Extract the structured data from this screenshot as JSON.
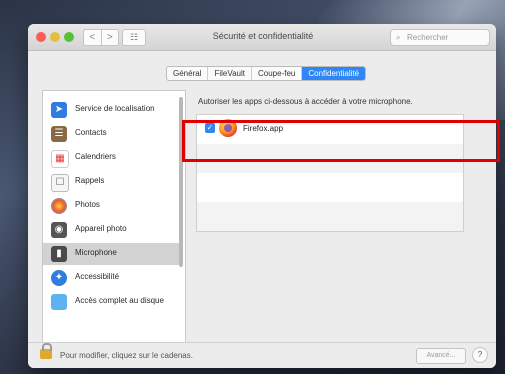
{
  "window": {
    "title": "Sécurité et confidentialité",
    "search_placeholder": "Rechercher",
    "nav_back": "<",
    "nav_forward": ">",
    "grid": "☷"
  },
  "tabs": [
    {
      "label": "Général",
      "active": false
    },
    {
      "label": "FileVault",
      "active": false
    },
    {
      "label": "Coupe-feu",
      "active": false
    },
    {
      "label": "Confidentialité",
      "active": true
    }
  ],
  "sidebar": {
    "items": [
      {
        "label": "Service de localisation",
        "icon": "location-icon",
        "selected": false
      },
      {
        "label": "Contacts",
        "icon": "contacts-icon",
        "selected": false
      },
      {
        "label": "Calendriers",
        "icon": "calendar-icon",
        "selected": false
      },
      {
        "label": "Rappels",
        "icon": "reminders-icon",
        "selected": false
      },
      {
        "label": "Photos",
        "icon": "photos-icon",
        "selected": false
      },
      {
        "label": "Appareil photo",
        "icon": "camera-icon",
        "selected": false
      },
      {
        "label": "Microphone",
        "icon": "microphone-icon",
        "selected": true
      },
      {
        "label": "Accessibilité",
        "icon": "accessibility-icon",
        "selected": false
      },
      {
        "label": "Accès complet au disque",
        "icon": "folder-icon",
        "selected": false
      }
    ]
  },
  "main": {
    "prompt": "Autoriser les apps ci-dessous à accéder à votre microphone.",
    "apps": [
      {
        "name": "Firefox.app",
        "checked": true,
        "icon": "firefox-icon"
      }
    ]
  },
  "footer": {
    "lock_text": "Pour modifier, cliquez sur le cadenas.",
    "advanced_label": "Avancé...",
    "help_label": "?"
  },
  "colors": {
    "accent": "#2f86f6",
    "highlight": "#e10000"
  }
}
